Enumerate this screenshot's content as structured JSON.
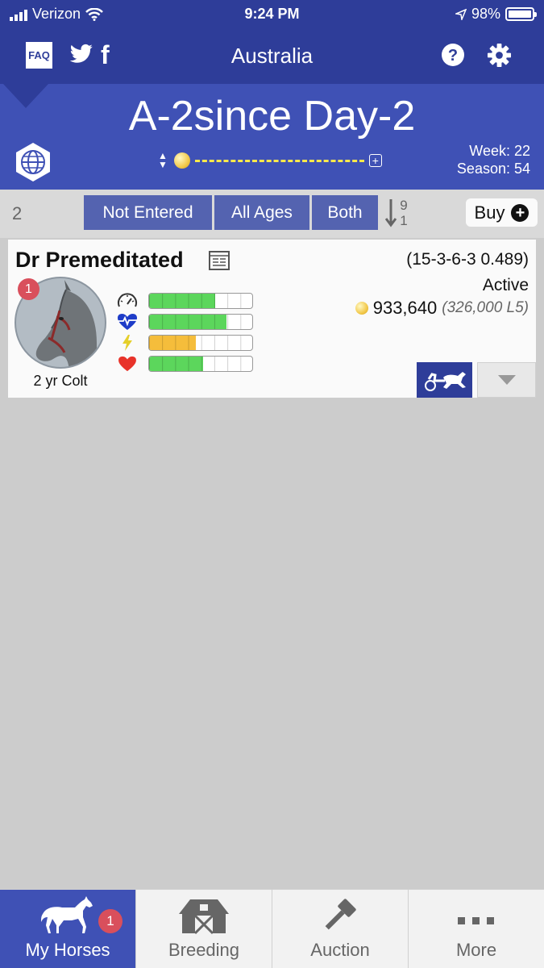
{
  "status_bar": {
    "carrier": "Verizon",
    "time": "9:24 PM",
    "battery": "98%"
  },
  "header": {
    "faq_label": "FAQ",
    "title": "Australia"
  },
  "banner": {
    "title": "A-2since Day-2",
    "week": "Week: 22",
    "season": "Season: 54"
  },
  "filters": {
    "count": "2",
    "entry_filter": "Not Entered",
    "age_filter": "All Ages",
    "sex_filter": "Both",
    "sort_top": "9",
    "sort_bottom": "1",
    "buy_label": "Buy"
  },
  "horse": {
    "name": "Dr Premeditated",
    "record": "(15-3-6-3 0.489)",
    "status": "Active",
    "earnings": "933,640",
    "earnings_sub": "(326,000 L5)",
    "age_sex": "2 yr Colt",
    "notification_count": "1",
    "stats": [
      {
        "name": "speed",
        "icon": "speedometer-icon",
        "level": 0.64,
        "color": "#5cd65c"
      },
      {
        "name": "stamina",
        "icon": "heartbeat-icon",
        "level": 0.75,
        "color": "#5cd65c"
      },
      {
        "name": "energy",
        "icon": "lightning-icon",
        "level": 0.45,
        "color": "#f5bd3b"
      },
      {
        "name": "health",
        "icon": "heart-icon",
        "level": 0.52,
        "color": "#5cd65c"
      }
    ]
  },
  "tabs": [
    {
      "label": "My Horses",
      "icon": "horse-icon",
      "badge": "1",
      "active": true
    },
    {
      "label": "Breeding",
      "icon": "barn-icon"
    },
    {
      "label": "Auction",
      "icon": "gavel-icon"
    },
    {
      "label": "More",
      "icon": "more-dots-icon"
    }
  ],
  "colors": {
    "header_bg": "#2e3d99",
    "banner_bg": "#3f51b5",
    "filter_button_bg": "#5463b0",
    "badge_red": "#d94f5c"
  }
}
